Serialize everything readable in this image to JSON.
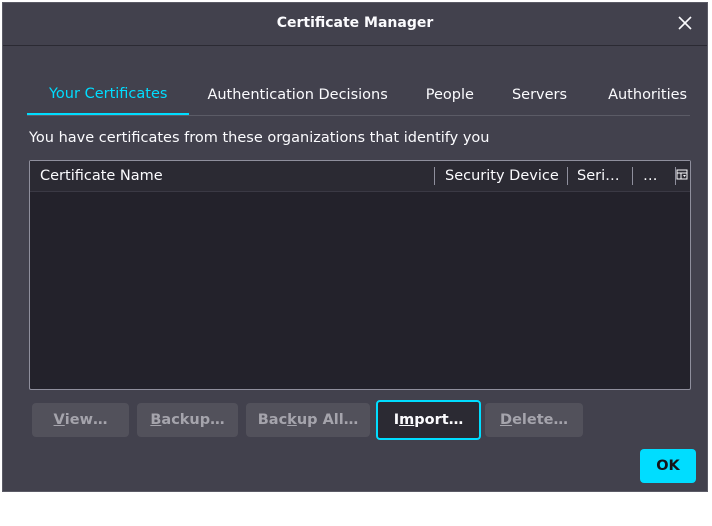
{
  "window": {
    "title": "Certificate Manager"
  },
  "tabs": [
    {
      "label": "Your Certificates",
      "selected": true
    },
    {
      "label": "Authentication Decisions",
      "selected": false
    },
    {
      "label": "People",
      "selected": false
    },
    {
      "label": "Servers",
      "selected": false
    },
    {
      "label": "Authorities",
      "selected": false
    }
  ],
  "description": "You have certificates from these organizations that identify you",
  "tree": {
    "columns": [
      {
        "label": "Certificate Name"
      },
      {
        "label": "Security Device"
      },
      {
        "label": "Seri…"
      },
      {
        "label": "…"
      }
    ],
    "rows": []
  },
  "buttons": {
    "view": {
      "label_ul": "V",
      "label_rest": "iew…",
      "enabled": false
    },
    "backup": {
      "label_ul": "B",
      "label_rest": "ackup…",
      "enabled": false
    },
    "backup_all": {
      "label_pre": "Bac",
      "label_ul": "k",
      "label_rest": "up All…",
      "enabled": false
    },
    "import": {
      "label_pre": "I",
      "label_ul": "m",
      "label_rest": "port…",
      "enabled": true
    },
    "delete": {
      "label_ul": "D",
      "label_rest": "elete…",
      "enabled": false
    },
    "ok": {
      "label": "OK"
    }
  },
  "colors": {
    "accent": "#00ddff",
    "dialog_bg": "#42414d",
    "tree_bg": "#23222b"
  }
}
